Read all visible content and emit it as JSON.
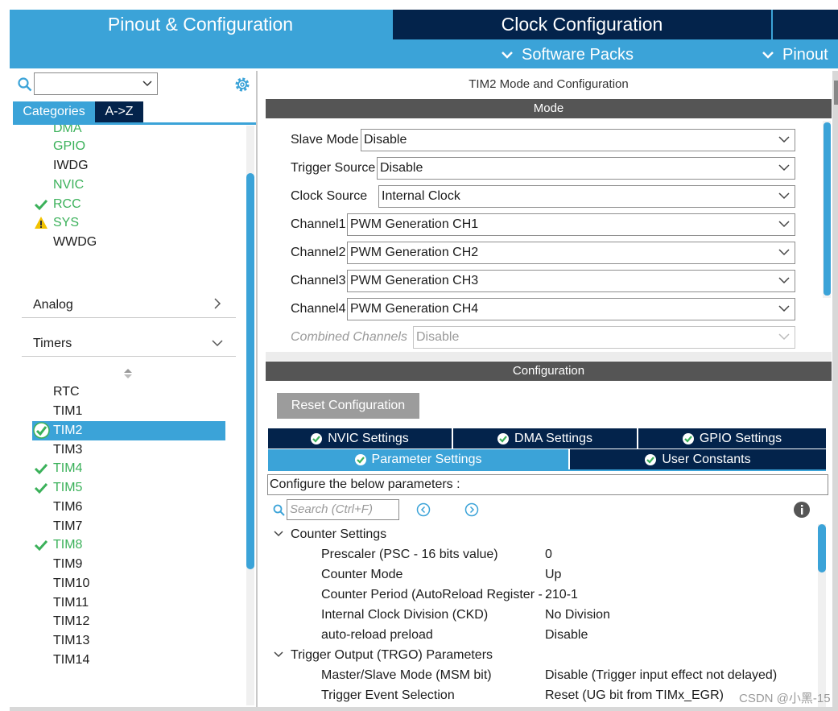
{
  "top_tabs": {
    "pinout": "Pinout & Configuration",
    "clock": "Clock Configuration",
    "software_packs": "Software Packs",
    "pinout_menu": "Pinout"
  },
  "left": {
    "categories_tab": "Categories",
    "az_tab": "A->Z",
    "system_items": [
      {
        "label": "DMA",
        "state": "enabled"
      },
      {
        "label": "GPIO",
        "state": "enabled"
      },
      {
        "label": "IWDG",
        "state": "none"
      },
      {
        "label": "NVIC",
        "state": "enabled"
      },
      {
        "label": "RCC",
        "state": "configured"
      },
      {
        "label": "SYS",
        "state": "warning"
      },
      {
        "label": "WWDG",
        "state": "none"
      }
    ],
    "analog": "Analog",
    "timers": "Timers",
    "timer_items": [
      {
        "label": "RTC",
        "state": "none"
      },
      {
        "label": "TIM1",
        "state": "none"
      },
      {
        "label": "TIM2",
        "state": "selected"
      },
      {
        "label": "TIM3",
        "state": "none"
      },
      {
        "label": "TIM4",
        "state": "configured"
      },
      {
        "label": "TIM5",
        "state": "configured"
      },
      {
        "label": "TIM6",
        "state": "none"
      },
      {
        "label": "TIM7",
        "state": "none"
      },
      {
        "label": "TIM8",
        "state": "configured"
      },
      {
        "label": "TIM9",
        "state": "none"
      },
      {
        "label": "TIM10",
        "state": "none"
      },
      {
        "label": "TIM11",
        "state": "none"
      },
      {
        "label": "TIM12",
        "state": "none"
      },
      {
        "label": "TIM13",
        "state": "none"
      },
      {
        "label": "TIM14",
        "state": "none"
      }
    ]
  },
  "right": {
    "title": "TIM2 Mode and Configuration",
    "mode_header": "Mode",
    "mode_rows": [
      {
        "label": "Slave Mode",
        "value": "Disable"
      },
      {
        "label": "Trigger Source",
        "value": "Disable"
      },
      {
        "label": "Clock Source",
        "value": "Internal Clock"
      },
      {
        "label": "Channel1",
        "value": "PWM Generation CH1"
      },
      {
        "label": "Channel2",
        "value": "PWM Generation CH2"
      },
      {
        "label": "Channel3",
        "value": "PWM Generation CH3"
      },
      {
        "label": "Channel4",
        "value": "PWM Generation CH4"
      },
      {
        "label": "Combined Channels",
        "value": "Disable"
      }
    ],
    "config_header": "Configuration",
    "reset_button": "Reset Configuration",
    "tabs_row1": [
      "NVIC Settings",
      "DMA Settings",
      "GPIO Settings"
    ],
    "tabs_row2": [
      "Parameter Settings",
      "User Constants"
    ],
    "description": "Configure the below parameters :",
    "search_placeholder": "Search (Ctrl+F)",
    "groups": [
      {
        "title": "Counter Settings",
        "params": [
          {
            "key": "Prescaler (PSC - 16 bits value)",
            "value": "0"
          },
          {
            "key": "Counter Mode",
            "value": "Up"
          },
          {
            "key": "Counter Period (AutoReload Register - .",
            "value": "210-1"
          },
          {
            "key": "Internal Clock Division (CKD)",
            "value": "No Division"
          },
          {
            "key": "auto-reload preload",
            "value": "Disable"
          }
        ]
      },
      {
        "title": "Trigger Output (TRGO) Parameters",
        "params": [
          {
            "key": "Master/Slave Mode (MSM bit)",
            "value": "Disable (Trigger input effect not delayed)"
          },
          {
            "key": "Trigger Event Selection",
            "value": "Reset (UG bit from TIMx_EGR)"
          }
        ]
      }
    ]
  },
  "watermark": "CSDN @小黑-15",
  "colors": {
    "accent": "#3ba3d8",
    "navy": "#03234b",
    "green": "#3bb15a",
    "warning": "#f2c200",
    "header_gray": "#555555"
  }
}
